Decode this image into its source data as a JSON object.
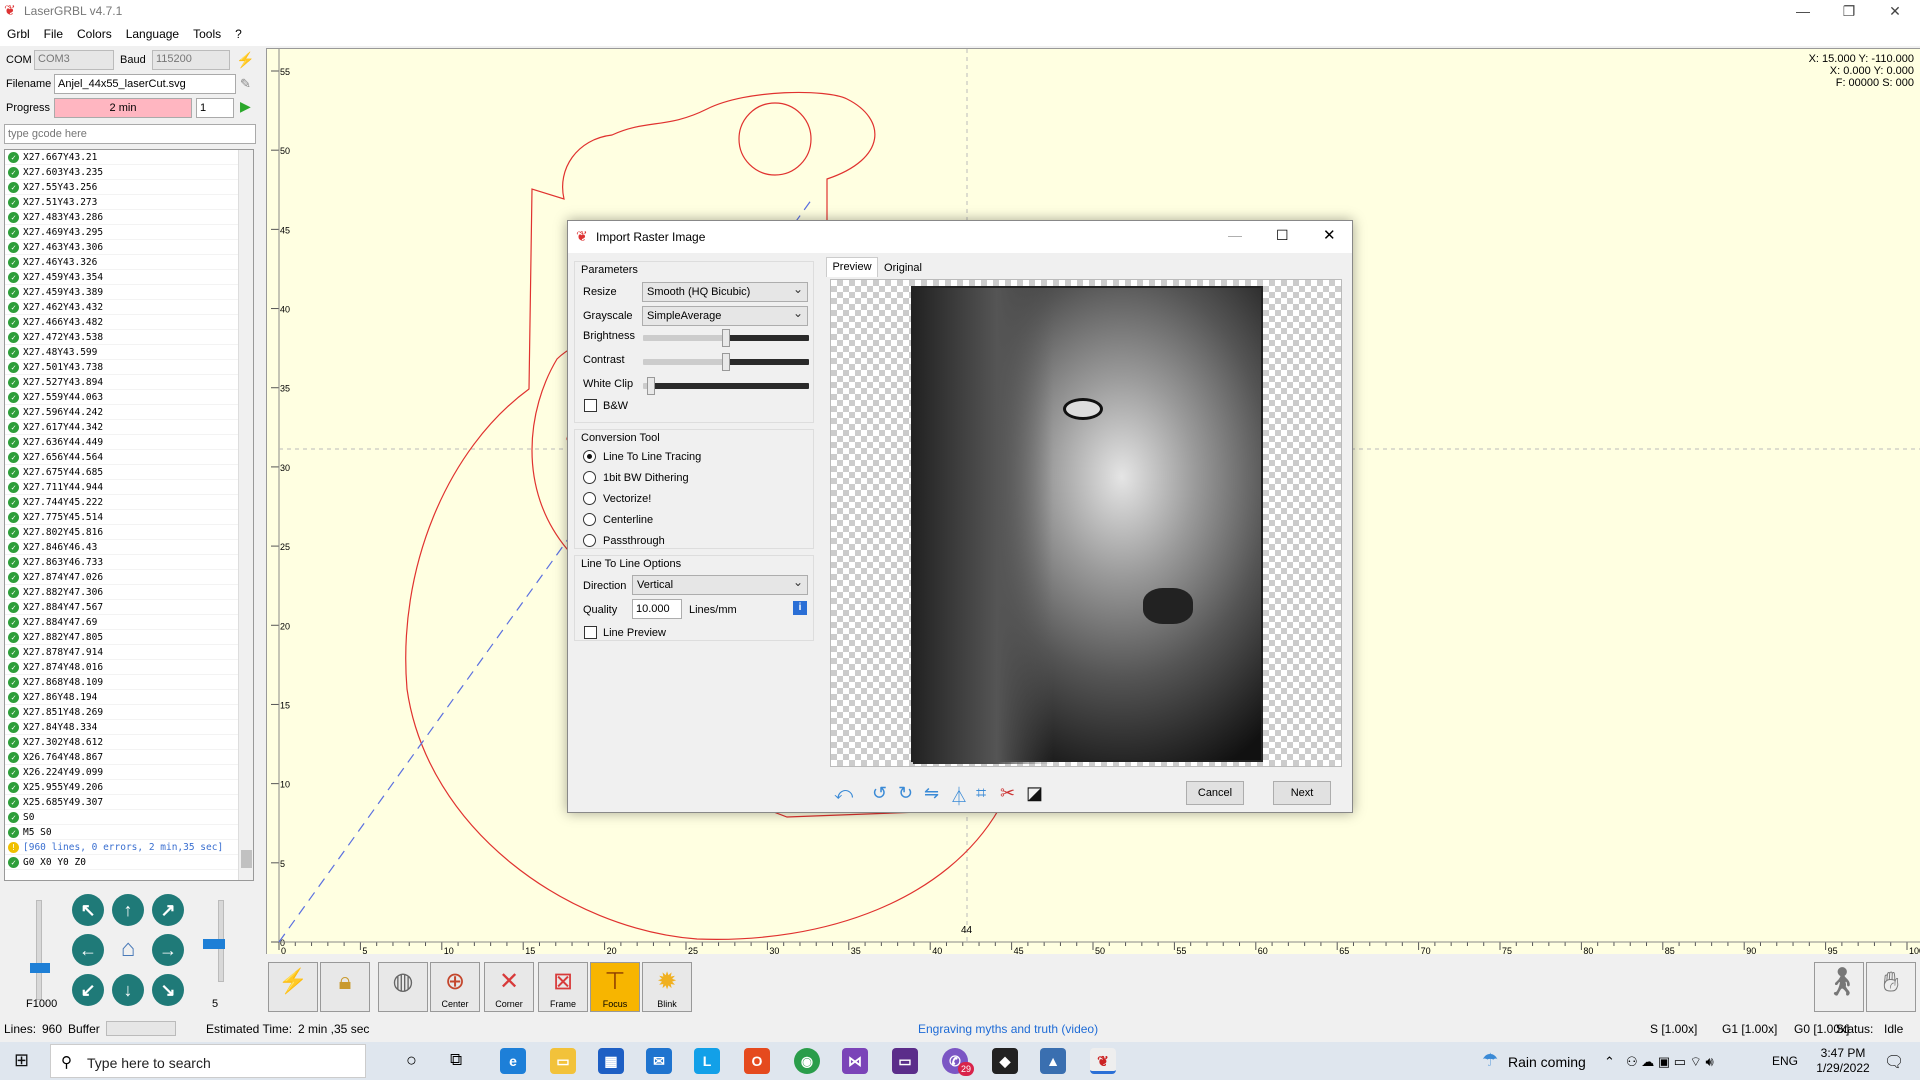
{
  "app": {
    "title": "LaserGRBL v4.7.1"
  },
  "menu": [
    "Grbl",
    "File",
    "Colors",
    "Language",
    "Tools",
    "?"
  ],
  "connection": {
    "com_label": "COM",
    "com_value": "COM3",
    "baud_label": "Baud",
    "baud_value": "115200"
  },
  "file": {
    "filename_label": "Filename",
    "filename_value": "Anjel_44x55_laserCut.svg"
  },
  "progress": {
    "label": "Progress",
    "value_text": "2 min",
    "repeat": "1"
  },
  "gcode_input": {
    "placeholder": "type gcode here"
  },
  "gcode_lines": [
    "X27.667Y43.21",
    "X27.603Y43.235",
    "X27.55Y43.256",
    "X27.51Y43.273",
    "X27.483Y43.286",
    "X27.469Y43.295",
    "X27.463Y43.306",
    "X27.46Y43.326",
    "X27.459Y43.354",
    "X27.459Y43.389",
    "X27.462Y43.432",
    "X27.466Y43.482",
    "X27.472Y43.538",
    "X27.48Y43.599",
    "X27.501Y43.738",
    "X27.527Y43.894",
    "X27.559Y44.063",
    "X27.596Y44.242",
    "X27.617Y44.342",
    "X27.636Y44.449",
    "X27.656Y44.564",
    "X27.675Y44.685",
    "X27.711Y44.944",
    "X27.744Y45.222",
    "X27.775Y45.514",
    "X27.802Y45.816",
    "X27.846Y46.43",
    "X27.863Y46.733",
    "X27.874Y47.026",
    "X27.882Y47.306",
    "X27.884Y47.567",
    "X27.884Y47.69",
    "X27.882Y47.805",
    "X27.878Y47.914",
    "X27.874Y48.016",
    "X27.868Y48.109",
    "X27.86Y48.194",
    "X27.851Y48.269",
    "X27.84Y48.334",
    "X27.302Y48.612",
    "X26.764Y48.867",
    "X26.224Y49.099",
    "X25.955Y49.206",
    "X25.685Y49.307",
    "S0",
    "M5 S0"
  ],
  "gcode_summary": "[960 lines, 0 errors, 2 min,35 sec]",
  "gcode_last": "G0 X0 Y0 Z0",
  "jog": {
    "feed": "F1000",
    "step": "5"
  },
  "coords": {
    "line1": "X: 15.000 Y: -110.000",
    "line2": "X: 0.000 Y: 0.000",
    "line3": "F: 00000 S: 000"
  },
  "axis": {
    "x_ticks": [
      "0",
      "5",
      "10",
      "15",
      "20",
      "25",
      "30",
      "35",
      "40",
      "45",
      "50",
      "55",
      "60",
      "65",
      "70",
      "75",
      "80",
      "85",
      "90",
      "95",
      "100"
    ],
    "y_ticks": [
      "55",
      "50",
      "45",
      "40",
      "35",
      "30",
      "25",
      "20",
      "15",
      "10",
      "5",
      "0"
    ],
    "width_marker": "44"
  },
  "toolbar": {
    "center": "Center",
    "corner": "Corner",
    "frame": "Frame",
    "focus": "Focus",
    "blink": "Blink"
  },
  "status": {
    "lines_label": "Lines:",
    "lines_value": "960",
    "buffer_label": "Buffer",
    "estimated_label": "Estimated Time:",
    "estimated_value": "2 min ,35 sec",
    "link": "Engraving myths and truth (video)",
    "s": "S [1.00x]",
    "g1": "G1 [1.00x]",
    "g0": "G0 [1.00x]",
    "status_label": "Status:",
    "status_value": "Idle"
  },
  "dialog": {
    "title": "Import Raster Image",
    "parameters_label": "Parameters",
    "resize_label": "Resize",
    "resize_value": "Smooth (HQ Bicubic)",
    "grayscale_label": "Grayscale",
    "grayscale_value": "SimpleAverage",
    "brightness_label": "Brightness",
    "brightness_level": 0.5,
    "contrast_label": "Contrast",
    "contrast_level": 0.5,
    "whiteclip_label": "White Clip",
    "whiteclip_level": 0.05,
    "bw_label": "B&W",
    "conversion_label": "Conversion Tool",
    "tools": [
      {
        "label": "Line To Line Tracing",
        "selected": true
      },
      {
        "label": "1bit BW Dithering",
        "selected": false
      },
      {
        "label": "Vectorize!",
        "selected": false
      },
      {
        "label": "Centerline",
        "selected": false
      },
      {
        "label": "Passthrough",
        "selected": false
      }
    ],
    "options_label": "Line To Line Options",
    "direction_label": "Direction",
    "direction_value": "Vertical",
    "quality_label": "Quality",
    "quality_value": "10.000",
    "quality_unit": "Lines/mm",
    "line_preview_label": "Line Preview",
    "tab_preview": "Preview",
    "tab_original": "Original",
    "cancel": "Cancel",
    "next": "Next"
  },
  "taskbar": {
    "search_placeholder": "Type here to search",
    "weather": "Rain coming",
    "lang": "ENG",
    "time": "3:47 PM",
    "date": "1/29/2022",
    "notif_badge": "29"
  }
}
